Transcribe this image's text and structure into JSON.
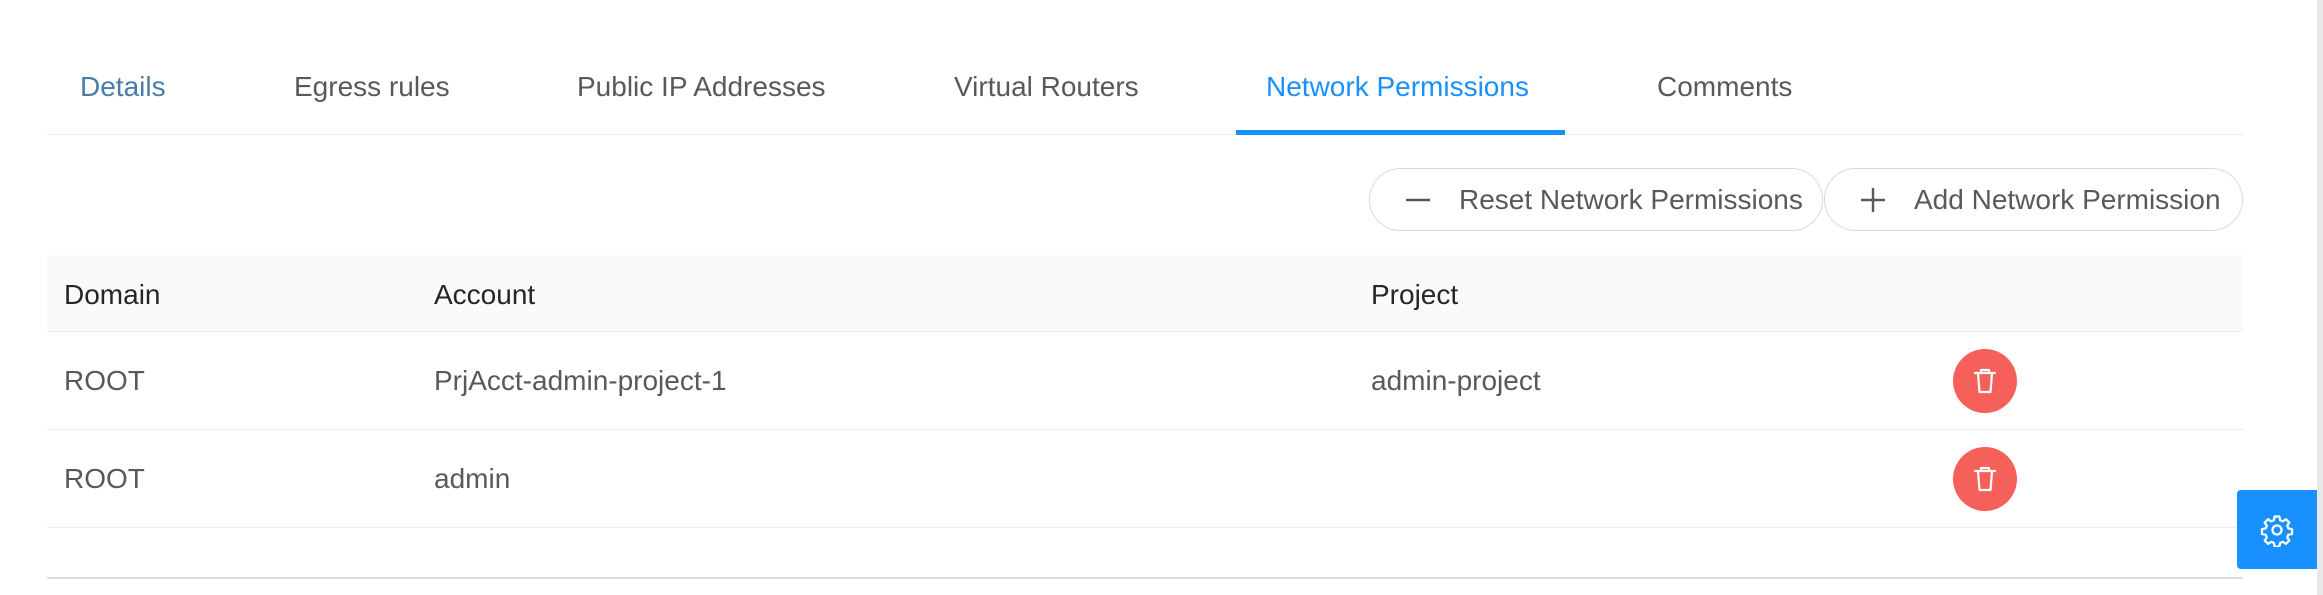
{
  "tabs": [
    {
      "label": "Details"
    },
    {
      "label": "Egress rules"
    },
    {
      "label": "Public IP Addresses"
    },
    {
      "label": "Virtual Routers"
    },
    {
      "label": "Network Permissions"
    },
    {
      "label": "Comments"
    }
  ],
  "active_tab": "Network Permissions",
  "actions": {
    "reset_label": "Reset Network Permissions",
    "add_label": "Add Network Permission"
  },
  "table": {
    "columns": [
      "Domain",
      "Account",
      "Project"
    ],
    "rows": [
      {
        "domain": "ROOT",
        "account": "PrjAcct-admin-project-1",
        "project": "admin-project"
      },
      {
        "domain": "ROOT",
        "account": "admin",
        "project": ""
      }
    ]
  },
  "icons": {
    "reset": "minus-icon",
    "add": "plus-icon",
    "row_action": "delete-icon",
    "settings": "gear-icon"
  },
  "colors": {
    "accent": "#1890ff",
    "danger": "#f5605a"
  }
}
